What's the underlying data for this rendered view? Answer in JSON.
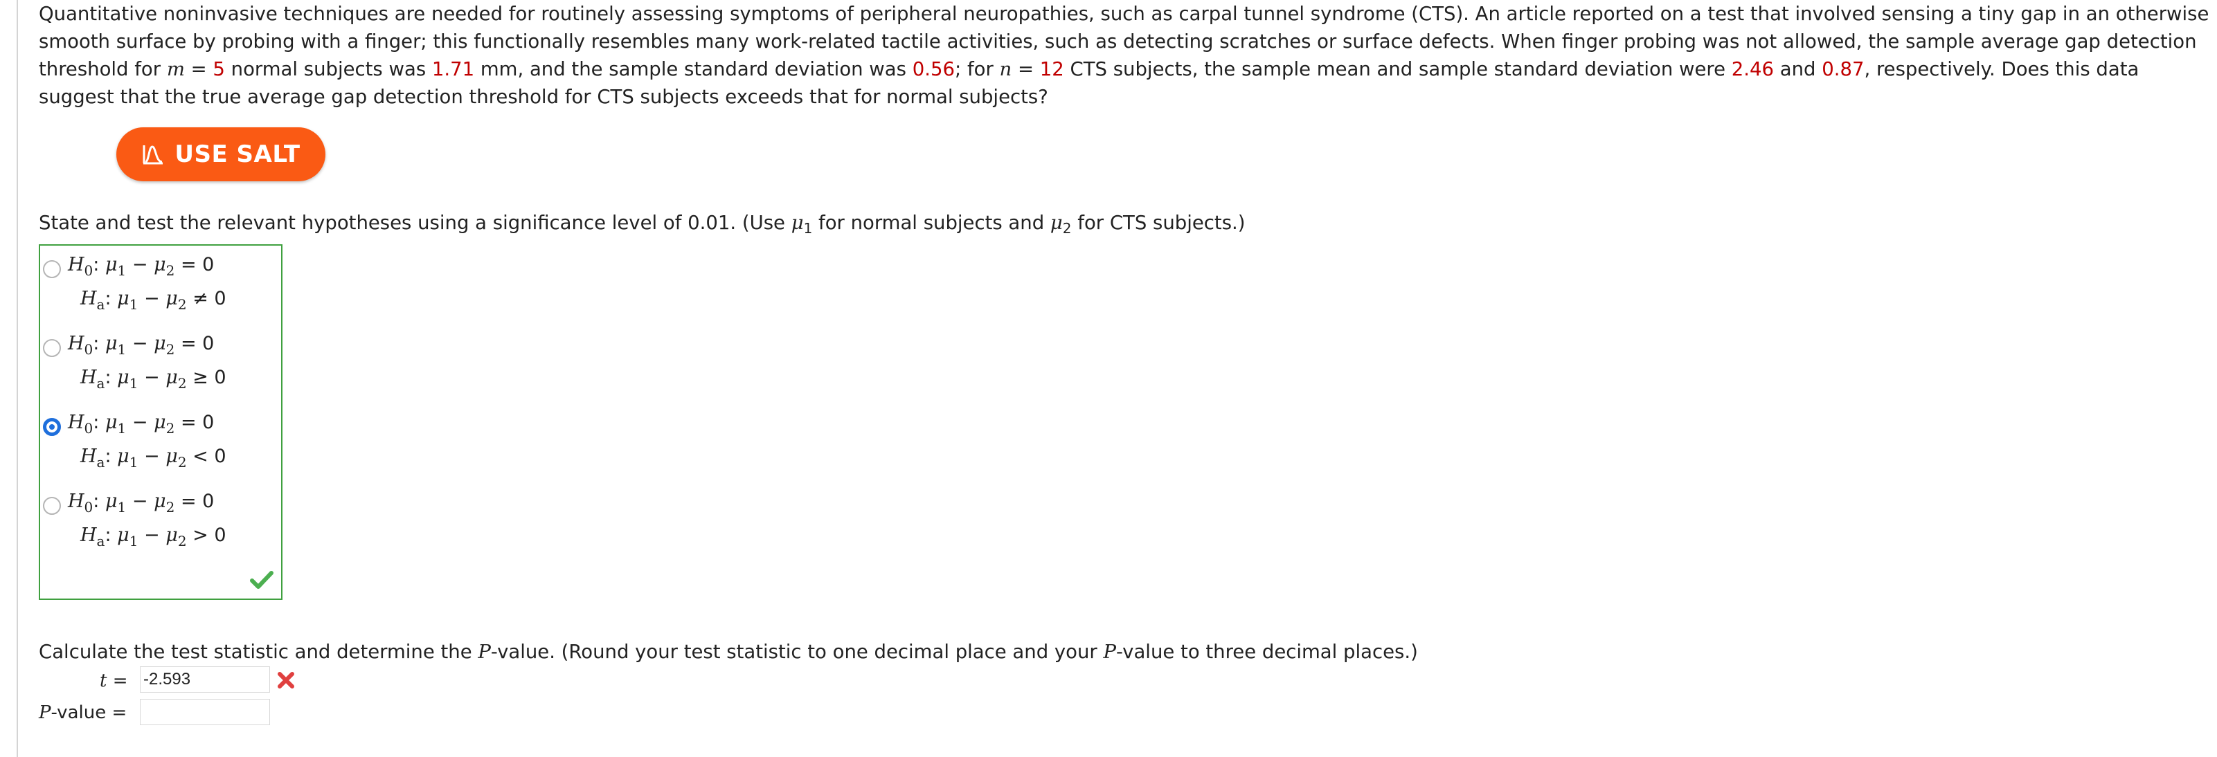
{
  "problem": {
    "part1": "Quantitative noninvasive techniques are needed for routinely assessing symptoms of peripheral neuropathies, such as carpal tunnel syndrome (CTS). An article reported on a test that involved sensing a tiny gap in an otherwise smooth surface by probing with a finger; this functionally resembles many work-related tactile activities, such as detecting scratches or surface defects. When finger probing was not allowed, the sample average gap detection threshold for ",
    "m_var": "m",
    "eq1": " = ",
    "m_value": "5",
    "part2": " normal subjects was ",
    "mean1": "1.71",
    "part3": " mm, and the sample standard deviation was ",
    "sd1": "0.56",
    "part4": "; for ",
    "n_var": "n",
    "eq2": " = ",
    "n_value": "12",
    "part5": " CTS subjects, the sample mean and sample standard deviation were ",
    "mean2": "2.46",
    "part6": " and ",
    "sd2": "0.87",
    "part7": ", respectively. Does this data suggest that the true average gap detection threshold for CTS subjects exceeds that for normal subjects?"
  },
  "salt_button": {
    "label": "USE SALT",
    "color": "#fa5a14"
  },
  "question1": {
    "text_a": "State and test the relevant hypotheses using a significance level of 0.01. (Use ",
    "mu": "μ",
    "sub1": "1",
    "text_b": " for normal subjects and ",
    "sub2": "2",
    "text_c": " for CTS subjects.)"
  },
  "hypotheses": [
    {
      "h0_rel": " = 0",
      "ha_rel": " ≠ 0",
      "selected": false
    },
    {
      "h0_rel": " = 0",
      "ha_rel": " ≥ 0",
      "selected": false
    },
    {
      "h0_rel": " = 0",
      "ha_rel": " < 0",
      "selected": true
    },
    {
      "h0_rel": " = 0",
      "ha_rel": " > 0",
      "selected": false
    }
  ],
  "hyp_symbols": {
    "H": "H",
    "sub0": "0",
    "suba": "a",
    "mu": "μ",
    "one": "1",
    "two": "2",
    "minus": " − ",
    "colon": ": "
  },
  "question2": {
    "text_a": "Calculate the test statistic and determine the ",
    "p_italic": "P",
    "text_b": "-value. (Round your test statistic to one decimal place and your ",
    "text_c": "-value to three decimal places.)"
  },
  "t_field": {
    "var": "t",
    "eq": " = ",
    "value": "-2.593",
    "status": "incorrect"
  },
  "p_field": {
    "var": "P",
    "label_rest": "-value  = ",
    "value": ""
  },
  "colors": {
    "given_values": "#c00000",
    "correct": "#3fa03f",
    "incorrect": "#e0403f",
    "selected_radio": "#1f6fdc"
  }
}
